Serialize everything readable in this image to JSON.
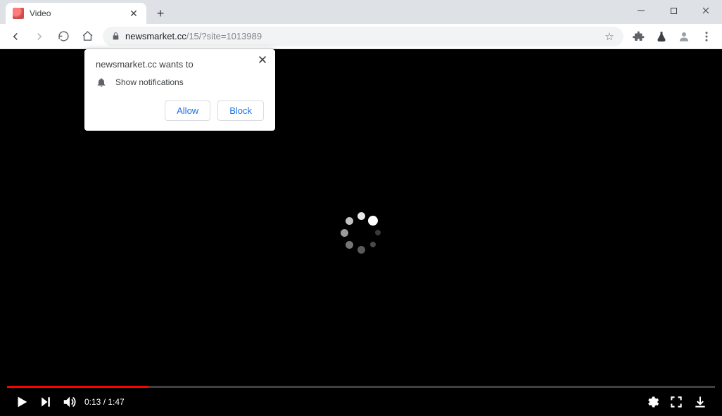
{
  "tab": {
    "title": "Video"
  },
  "url": {
    "domain": "newsmarket.cc",
    "rest": "/15/?site=1013989"
  },
  "prompt": {
    "title": "newsmarket.cc wants to",
    "permission": "Show notifications",
    "allow": "Allow",
    "block": "Block"
  },
  "player": {
    "current": "0:13",
    "duration": "1:47",
    "progress_pct": 20
  }
}
